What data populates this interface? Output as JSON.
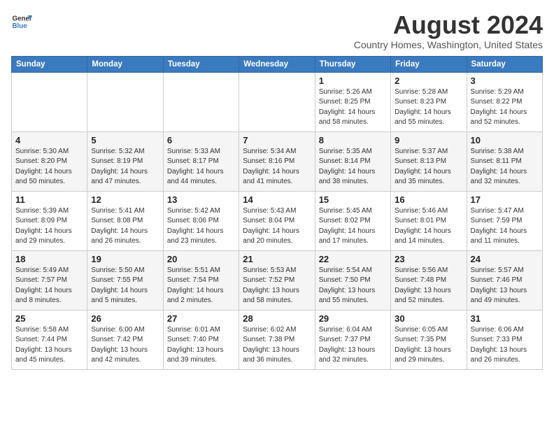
{
  "header": {
    "logo_line1": "General",
    "logo_line2": "Blue",
    "month": "August 2024",
    "location": "Country Homes, Washington, United States"
  },
  "weekdays": [
    "Sunday",
    "Monday",
    "Tuesday",
    "Wednesday",
    "Thursday",
    "Friday",
    "Saturday"
  ],
  "weeks": [
    [
      {
        "day": "",
        "info": ""
      },
      {
        "day": "",
        "info": ""
      },
      {
        "day": "",
        "info": ""
      },
      {
        "day": "",
        "info": ""
      },
      {
        "day": "1",
        "info": "Sunrise: 5:26 AM\nSunset: 8:25 PM\nDaylight: 14 hours\nand 58 minutes."
      },
      {
        "day": "2",
        "info": "Sunrise: 5:28 AM\nSunset: 8:23 PM\nDaylight: 14 hours\nand 55 minutes."
      },
      {
        "day": "3",
        "info": "Sunrise: 5:29 AM\nSunset: 8:22 PM\nDaylight: 14 hours\nand 52 minutes."
      }
    ],
    [
      {
        "day": "4",
        "info": "Sunrise: 5:30 AM\nSunset: 8:20 PM\nDaylight: 14 hours\nand 50 minutes."
      },
      {
        "day": "5",
        "info": "Sunrise: 5:32 AM\nSunset: 8:19 PM\nDaylight: 14 hours\nand 47 minutes."
      },
      {
        "day": "6",
        "info": "Sunrise: 5:33 AM\nSunset: 8:17 PM\nDaylight: 14 hours\nand 44 minutes."
      },
      {
        "day": "7",
        "info": "Sunrise: 5:34 AM\nSunset: 8:16 PM\nDaylight: 14 hours\nand 41 minutes."
      },
      {
        "day": "8",
        "info": "Sunrise: 5:35 AM\nSunset: 8:14 PM\nDaylight: 14 hours\nand 38 minutes."
      },
      {
        "day": "9",
        "info": "Sunrise: 5:37 AM\nSunset: 8:13 PM\nDaylight: 14 hours\nand 35 minutes."
      },
      {
        "day": "10",
        "info": "Sunrise: 5:38 AM\nSunset: 8:11 PM\nDaylight: 14 hours\nand 32 minutes."
      }
    ],
    [
      {
        "day": "11",
        "info": "Sunrise: 5:39 AM\nSunset: 8:09 PM\nDaylight: 14 hours\nand 29 minutes."
      },
      {
        "day": "12",
        "info": "Sunrise: 5:41 AM\nSunset: 8:08 PM\nDaylight: 14 hours\nand 26 minutes."
      },
      {
        "day": "13",
        "info": "Sunrise: 5:42 AM\nSunset: 8:06 PM\nDaylight: 14 hours\nand 23 minutes."
      },
      {
        "day": "14",
        "info": "Sunrise: 5:43 AM\nSunset: 8:04 PM\nDaylight: 14 hours\nand 20 minutes."
      },
      {
        "day": "15",
        "info": "Sunrise: 5:45 AM\nSunset: 8:02 PM\nDaylight: 14 hours\nand 17 minutes."
      },
      {
        "day": "16",
        "info": "Sunrise: 5:46 AM\nSunset: 8:01 PM\nDaylight: 14 hours\nand 14 minutes."
      },
      {
        "day": "17",
        "info": "Sunrise: 5:47 AM\nSunset: 7:59 PM\nDaylight: 14 hours\nand 11 minutes."
      }
    ],
    [
      {
        "day": "18",
        "info": "Sunrise: 5:49 AM\nSunset: 7:57 PM\nDaylight: 14 hours\nand 8 minutes."
      },
      {
        "day": "19",
        "info": "Sunrise: 5:50 AM\nSunset: 7:55 PM\nDaylight: 14 hours\nand 5 minutes."
      },
      {
        "day": "20",
        "info": "Sunrise: 5:51 AM\nSunset: 7:54 PM\nDaylight: 14 hours\nand 2 minutes."
      },
      {
        "day": "21",
        "info": "Sunrise: 5:53 AM\nSunset: 7:52 PM\nDaylight: 13 hours\nand 58 minutes."
      },
      {
        "day": "22",
        "info": "Sunrise: 5:54 AM\nSunset: 7:50 PM\nDaylight: 13 hours\nand 55 minutes."
      },
      {
        "day": "23",
        "info": "Sunrise: 5:56 AM\nSunset: 7:48 PM\nDaylight: 13 hours\nand 52 minutes."
      },
      {
        "day": "24",
        "info": "Sunrise: 5:57 AM\nSunset: 7:46 PM\nDaylight: 13 hours\nand 49 minutes."
      }
    ],
    [
      {
        "day": "25",
        "info": "Sunrise: 5:58 AM\nSunset: 7:44 PM\nDaylight: 13 hours\nand 45 minutes."
      },
      {
        "day": "26",
        "info": "Sunrise: 6:00 AM\nSunset: 7:42 PM\nDaylight: 13 hours\nand 42 minutes."
      },
      {
        "day": "27",
        "info": "Sunrise: 6:01 AM\nSunset: 7:40 PM\nDaylight: 13 hours\nand 39 minutes."
      },
      {
        "day": "28",
        "info": "Sunrise: 6:02 AM\nSunset: 7:38 PM\nDaylight: 13 hours\nand 36 minutes."
      },
      {
        "day": "29",
        "info": "Sunrise: 6:04 AM\nSunset: 7:37 PM\nDaylight: 13 hours\nand 32 minutes."
      },
      {
        "day": "30",
        "info": "Sunrise: 6:05 AM\nSunset: 7:35 PM\nDaylight: 13 hours\nand 29 minutes."
      },
      {
        "day": "31",
        "info": "Sunrise: 6:06 AM\nSunset: 7:33 PM\nDaylight: 13 hours\nand 26 minutes."
      }
    ]
  ]
}
